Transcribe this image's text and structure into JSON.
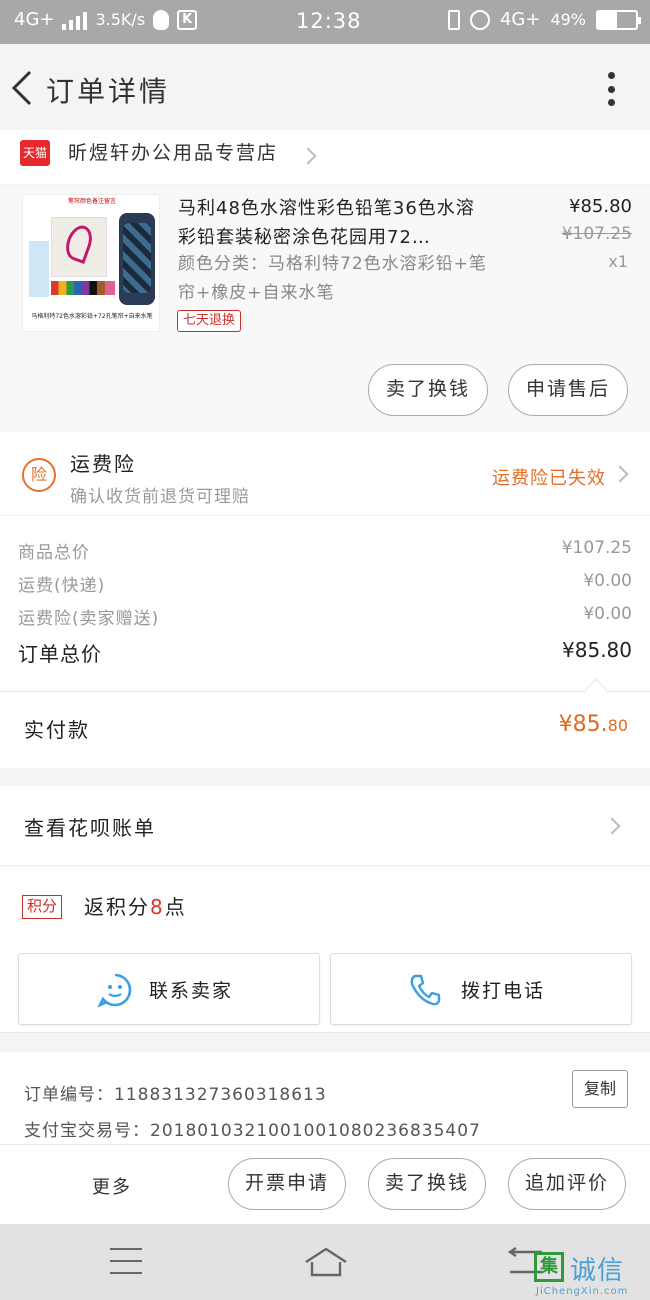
{
  "status_bar": {
    "network": "4G+",
    "speed": "3.5K/s",
    "app_icon_letter": "K",
    "time": "12:38",
    "network_right": "4G+",
    "battery_text": "49%",
    "battery_level": 0.49
  },
  "header": {
    "title": "订单详情"
  },
  "shop": {
    "badge": "天猫",
    "name": "昕煜轩办公用品专营店"
  },
  "product": {
    "title": "马利48色水溶性彩色铅笔36色水溶彩铅套装秘密涂色花园用72…",
    "spec": "颜色分类：马格利特72色水溶彩铅+笔帘+橡皮+自来水笔",
    "price": "¥85.80",
    "original_price": "¥107.25",
    "quantity": "x1",
    "tag": "七天退换",
    "image_caption_top": "笔帘颜色备注留言",
    "image_caption_bottom": "马格利特72色水溶彩铅+72孔笔帘+自来水笔",
    "buttons": [
      "卖了换钱",
      "申请售后"
    ]
  },
  "insurance": {
    "icon_text": "险",
    "title": "运费险",
    "subtitle": "确认收货前退货可理赔",
    "status": "运费险已失效",
    "status_color": "#e0702a"
  },
  "summary": {
    "rows": [
      {
        "label": "商品总价",
        "value": "¥107.25"
      },
      {
        "label": "运费(快递)",
        "value": "¥0.00"
      },
      {
        "label": "运费险(卖家赠送)",
        "value": "¥0.00"
      },
      {
        "label": "订单总价",
        "value": "¥85.80"
      }
    ]
  },
  "payment": {
    "label": "实付款",
    "amount_main": "¥85.",
    "amount_cents": "80",
    "color": "#e06a1e"
  },
  "huabei": {
    "label": "查看花呗账单"
  },
  "points": {
    "badge": "积分",
    "prefix": "返积分",
    "count": "8",
    "suffix": "点"
  },
  "contact": {
    "seller_label": "联系卖家",
    "seller_icon": "chat-face-icon",
    "call_label": "拨打电话",
    "call_icon": "phone-icon",
    "accent": "#3a9fe0"
  },
  "order_info": {
    "order_no_label": "订单编号：",
    "order_no": "118831327360318613",
    "alipay_label": "支付宝交易号：",
    "alipay_no": "2018010321001001080236835407",
    "copy_label": "复制"
  },
  "action_bar": {
    "more": "更多",
    "buttons": [
      "开票申请",
      "卖了换钱",
      "追加评价"
    ]
  },
  "watermark": {
    "box": "集",
    "text": "诚信",
    "url": "JiChengXin.com"
  }
}
